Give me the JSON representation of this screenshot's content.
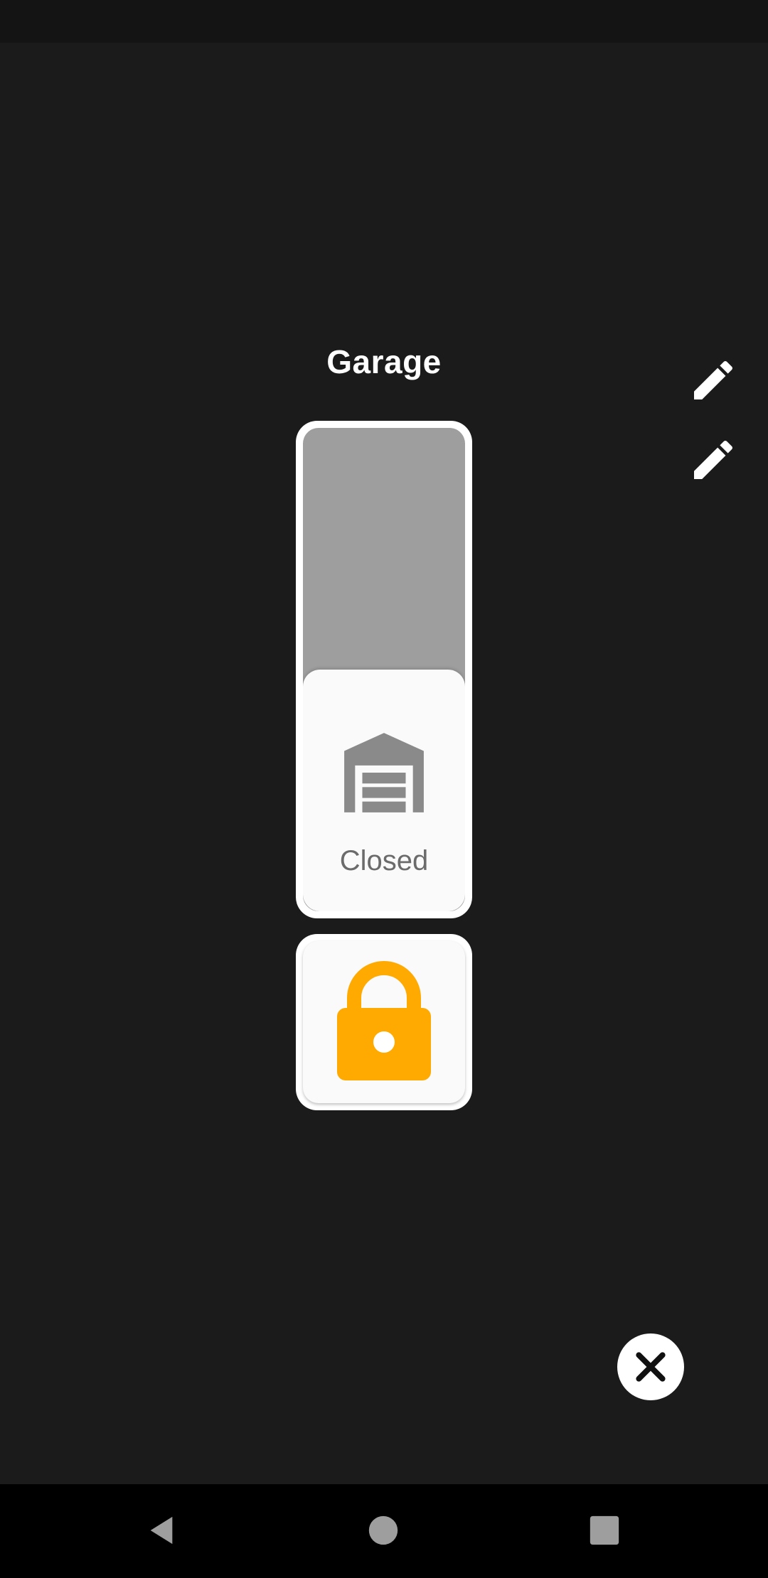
{
  "dialog": {
    "title": "Garage"
  },
  "cover": {
    "state_label": "Closed",
    "position_fraction": 0.5,
    "icon": "garage-icon"
  },
  "lock": {
    "icon": "lock-open-icon",
    "accent_color": "#FFAA00"
  },
  "actions": {
    "edit_icon": "pencil-icon",
    "close_icon": "close-icon"
  },
  "navigation": {
    "back_icon": "back-triangle-icon",
    "home_icon": "home-circle-icon",
    "recents_icon": "recents-square-icon"
  }
}
